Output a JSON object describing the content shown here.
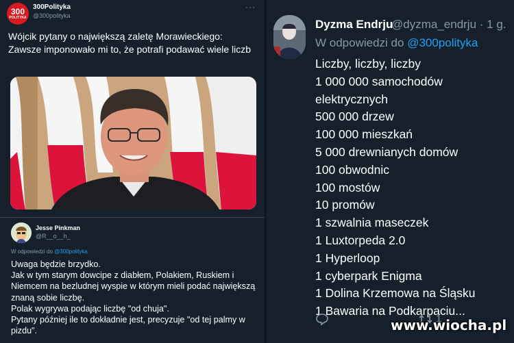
{
  "tweet1": {
    "avatar_number": "300",
    "avatar_subtext": "POLITYKA",
    "author_name": "300Polityka",
    "author_handle": "@300polityka",
    "text": "Wójcik pytany o największą zaletę Morawieckiego: Zawsze imponowało mi to, że potrafi podawać wiele liczb"
  },
  "tweet2": {
    "author_name": "Jesse Pinkman",
    "author_handle": "@R__o__h_",
    "reply_prefix": "W odpowiedzi do",
    "reply_to": "@300polityka",
    "text": "Uwaga będzie brzydko.\nJak w tym starym dowcipe z diabłem, Polakiem, Ruskiem i Niemcem na bezludnej wyspie w którym mieli podać największą znaną sobie liczbę.\nPolak wygrywa podając liczbę \"od chuja\".\nPytany później ile to dokładnie jest, precyzuje \"od tej palmy w pizdu\"."
  },
  "tweet3": {
    "author_name": "Dyzma Endrju",
    "author_handle": "@dyzma_endrju · 1 g.",
    "reply_prefix": "W odpowiedzi do",
    "reply_to": "@300polityka",
    "lines": [
      "Liczby, liczby, liczby",
      "1 000 000 samochodów elektrycznych",
      "500 000 drzew",
      "100 000 mieszkań",
      "5 000 drewnianych domów",
      "100 obwodnic",
      "100 mostów",
      "10 promów",
      "1 szwalnia maseczek",
      "1 Luxtorpeda 2.0",
      "1 Hyperloop",
      "1 cyberpark Enigma",
      "1 Dolina Krzemowa na Śląsku",
      "1 Bawaria na Podkarpaciu..."
    ],
    "actions": {
      "reply_icon": "reply-icon",
      "retweet_icon": "retweet-icon",
      "retweet_count": "1"
    }
  },
  "watermark": "www.wiocha.pl",
  "colors": {
    "background": "#15202b",
    "link": "#1da1f2",
    "muted": "#8899a6",
    "flag_red": "#dc143c"
  }
}
